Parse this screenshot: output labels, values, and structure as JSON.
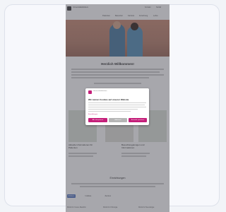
{
  "browser": {
    "card_label": ""
  },
  "site": {
    "logo_text": "Universitätsklinikum",
    "utility_links": [
      "Kontakt",
      "Notfall"
    ],
    "nav": [
      "Patienten",
      "Besucher",
      "Karriere",
      "Forschung",
      "Lehre"
    ],
    "hero_caption": "",
    "welcome_heading": "Herzlich Willkommen!",
    "news_left": "Aktuelle Informationen für Patienten",
    "news_right": "Besuchsregelungen und Informationen",
    "centers_title": "Einrichtungen",
    "tabs": [
      "Kliniken",
      "Institute",
      "Zentren"
    ],
    "bottom_links": [
      "Klinik für Innere Medizin",
      "Klinik für Chirurgie",
      "Klinik für Neurologie"
    ]
  },
  "cookie_dialog": {
    "logo_text": "Universitätsklinikum",
    "title": "Wir nutzen Cookies auf unserer Website",
    "settings_link": "Einstellungen",
    "buttons": {
      "accept_all": "Alle akzeptieren",
      "reject": "Ablehnen",
      "save": "Auswahl speichern"
    }
  },
  "colors": {
    "accent": "#c41e79",
    "tab_active": "#5a7bc4"
  }
}
